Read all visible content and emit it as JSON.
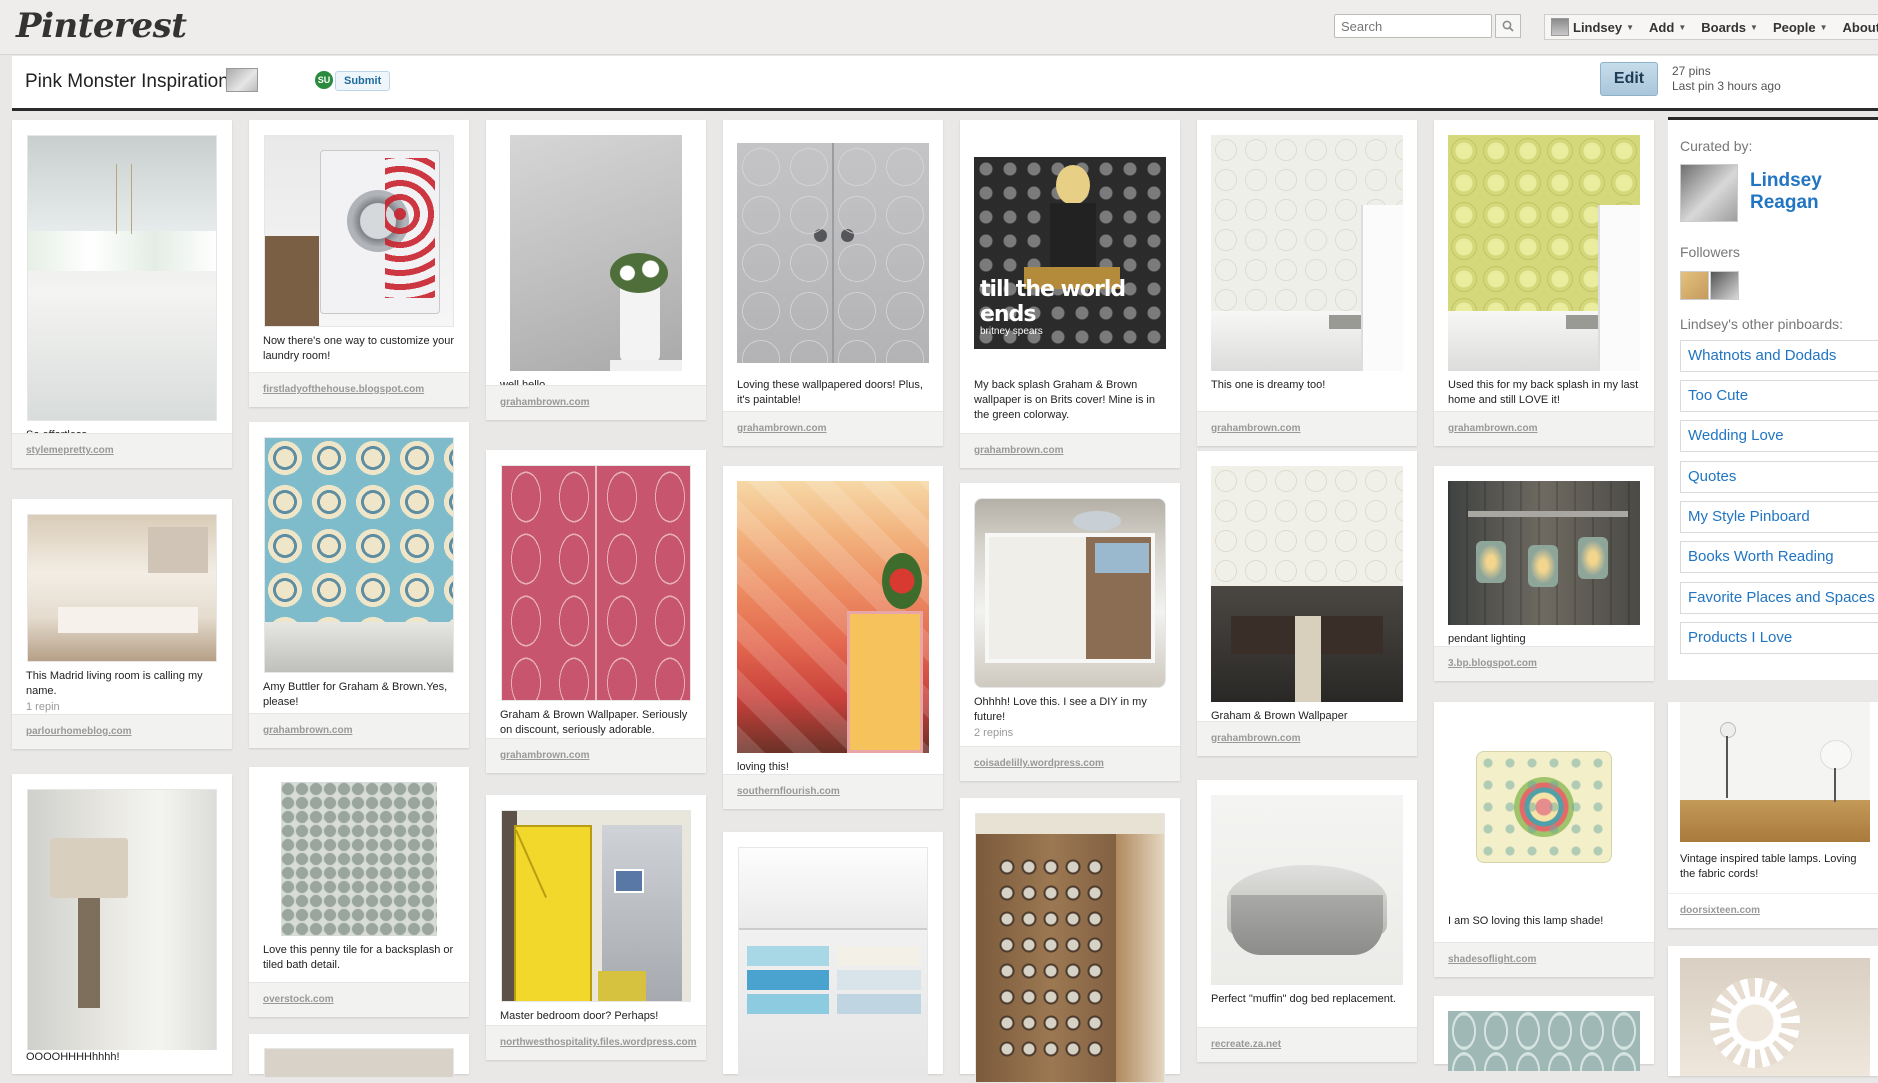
{
  "app": {
    "logo": "Pinterest"
  },
  "header": {
    "search_placeholder": "Search",
    "nav": [
      {
        "label": "Lindsey",
        "has_avatar": true
      },
      {
        "label": "Add"
      },
      {
        "label": "Boards"
      },
      {
        "label": "People"
      },
      {
        "label": "About"
      }
    ]
  },
  "board": {
    "title": "Pink Monster Inspiration",
    "submit_label": "Submit",
    "stumbleupon_badge": "SU",
    "edit_label": "Edit",
    "pin_count": "27 pins",
    "last_pin": "Last pin 3 hours ago"
  },
  "sidebar": {
    "curated_by_label": "Curated by:",
    "curator_name": "Lindsey Reagan",
    "followers_label": "Followers",
    "other_boards_label": "Lindsey's other pinboards:",
    "boards": [
      "Whatnots and Dodads",
      "Too Cute",
      "Wedding Love",
      "Quotes",
      "My Style Pinboard",
      "Books Worth Reading",
      "Favorite Places and Spaces",
      "Products I Love"
    ]
  },
  "pins": [
    {
      "desc": "So effortless.",
      "repins": "",
      "source": "stylemepretty.com"
    },
    {
      "desc": "This Madrid living room is calling my name.",
      "repins": "1 repin",
      "source": "parlourhomeblog.com"
    },
    {
      "desc": "OOOOHHHHhhhh!",
      "repins": "",
      "source": ""
    },
    {
      "desc": "Now there's one way to customize your laundry room!",
      "repins": "",
      "source": "firstladyofthehouse.blogspot.com"
    },
    {
      "desc": "Amy Buttler for Graham & Brown.Yes, please!",
      "repins": "",
      "source": "grahambrown.com"
    },
    {
      "desc": "Love this penny tile for a backsplash or tiled bath detail.",
      "repins": "",
      "source": "overstock.com"
    },
    {
      "desc": "well hello...",
      "repins": "",
      "source": "grahambrown.com"
    },
    {
      "desc": "Graham & Brown Wallpaper. Seriously on discount, seriously adorable.",
      "repins": "",
      "source": "grahambrown.com"
    },
    {
      "desc": "Master bedroom door? Perhaps!",
      "repins": "",
      "source": "northwesthospitality.files.wordpress.com"
    },
    {
      "desc": "Loving these wallpapered doors! Plus, it's paintable!",
      "repins": "",
      "source": "grahambrown.com"
    },
    {
      "desc": "loving this!",
      "repins": "",
      "source": "southernflourish.com"
    },
    {
      "desc": "My back splash Graham & Brown wallpaper is on Brits cover! Mine is in the green colorway.",
      "repins": "",
      "source": "grahambrown.com",
      "overlay": "till the world ends",
      "overlay_sub": "britney spears"
    },
    {
      "desc": "Ohhhh! Love this. I see a DIY in my future!",
      "repins": "2 repins",
      "source": "coisadelilly.wordpress.com"
    },
    {
      "desc": "This one is dreamy too!",
      "repins": "",
      "source": "grahambrown.com"
    },
    {
      "desc": "Graham & Brown Wallpaper",
      "repins": "",
      "source": "grahambrown.com"
    },
    {
      "desc": "Perfect \"muffin\" dog bed replacement.",
      "repins": "",
      "source": "recreate.za.net"
    },
    {
      "desc": "Used this for my back splash in my last home and still LOVE it!",
      "repins": "",
      "source": "grahambrown.com"
    },
    {
      "desc": "pendant lighting",
      "repins": "",
      "source": "3.bp.blogspot.com"
    },
    {
      "desc": "I am SO loving this lamp shade!",
      "repins": "",
      "source": "shadesoflight.com"
    },
    {
      "desc": "Vintage inspired table lamps. Loving the fabric cords!",
      "repins": "",
      "source": "doorsixteen.com"
    }
  ]
}
